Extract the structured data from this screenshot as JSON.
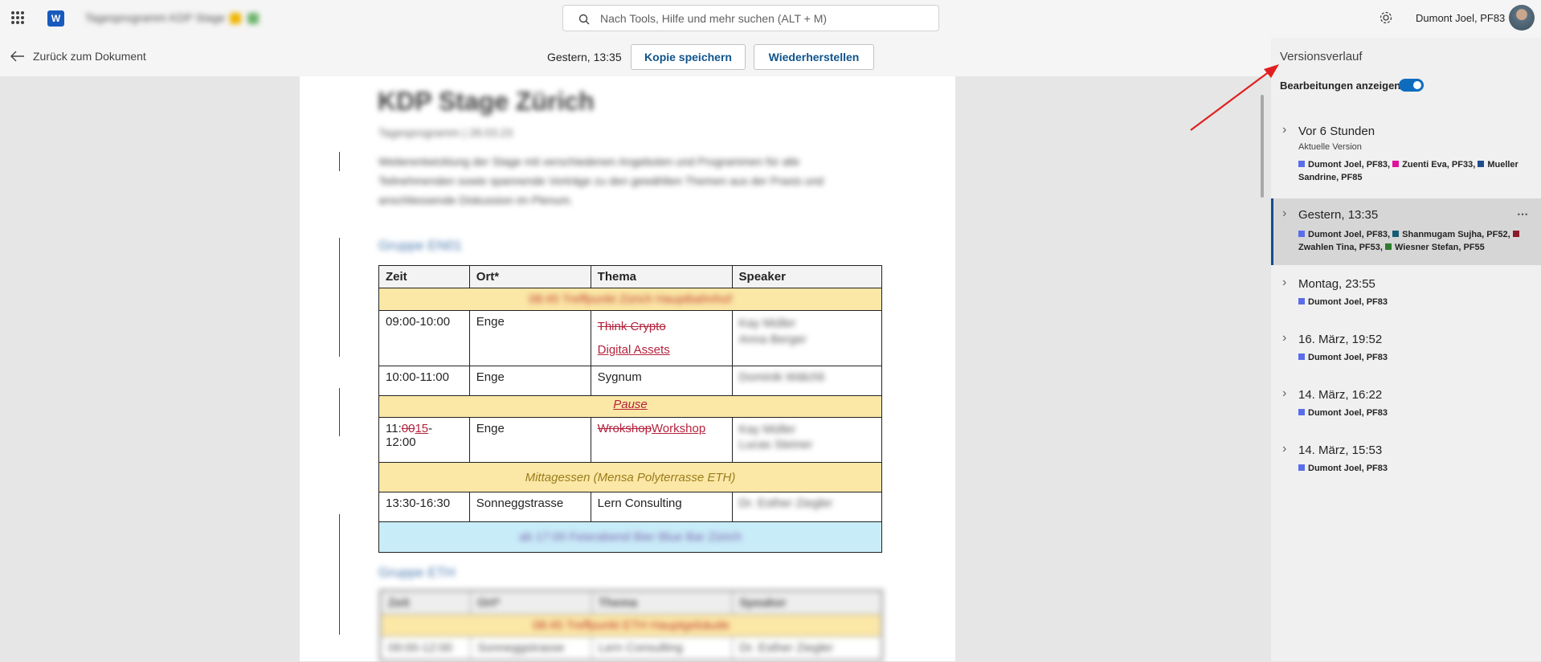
{
  "topbar": {
    "doc_title": "Tagesprogramm KDP Stage",
    "search_placeholder": "Nach Tools, Hilfe und mehr suchen (ALT + M)",
    "user_name": "Dumont Joel, PF83"
  },
  "commandbar": {
    "back_label": "Zurück zum Dokument",
    "version_time": "Gestern, 13:35",
    "copy_button": "Kopie speichern",
    "restore_button": "Wiederherstellen"
  },
  "document": {
    "title": "KDP Stage Zürich",
    "subtitle": "Tagesprogramm | 28.03.23",
    "paragraph": "Weiterentwicklung der Stage mit verschiedenen Angeboten und Programmen für alle Teilnehmenden sowie spannende Vorträge zu den gewählten Themen aus der Praxis und anschliessende Diskussion im Plenum.",
    "group1": "Gruppe EN01",
    "group2": "Gruppe ETH",
    "table1": {
      "headers": [
        "Zeit",
        "Ort*",
        "Thema",
        "Speaker"
      ],
      "row_banner": "08:45 Treffpunkt Zürich Hauptbahnhof",
      "rows": [
        {
          "zeit": "09:00-10:00",
          "ort": "Enge",
          "thema_del": "Think Crypto",
          "thema_ins": "Digital Assets",
          "speaker1": "Kay Müller",
          "speaker2": "Anna Berger"
        },
        {
          "zeit": "10:00-11:00",
          "ort": "Enge",
          "thema": "Sygnum",
          "speaker1": "Dominik Wälchli"
        },
        {
          "pause": "Pause"
        },
        {
          "zeit_a": "11:",
          "zeit_del": "00",
          "zeit_ins": "15",
          "zeit_b": "-",
          "zeit_c": "12:00",
          "ort": "Enge",
          "thema_del": "Wrokshop",
          "thema_ins": "Workshop",
          "speaker1": "Kay Müller",
          "speaker2": "Lucas Steiner"
        },
        {
          "lunch": "Mittagessen (Mensa Polyterrasse ETH)"
        },
        {
          "zeit": "13:30-16:30",
          "ort": "Sonneggstrasse",
          "thema": "Lern Consulting",
          "speaker1": "Dr. Esther Ziegler"
        },
        {
          "end": "ab 17:00 Feierabend Bier Blue Bar Zürich"
        }
      ]
    },
    "table2": {
      "headers": [
        "Zeit",
        "Ort*",
        "Thema",
        "Speaker"
      ],
      "row_banner": "08:45 Treffpunkt ETH Hauptgebäude",
      "row": [
        "09:00-12:00",
        "Sonneggstrasse",
        "Lern Consulting",
        "Dr. Esther Ziegler"
      ]
    }
  },
  "panel": {
    "title": "Versionsverlauf",
    "toggle_label": "Bearbeitungen anzeigen",
    "versions": [
      {
        "time": "Vor 6 Stunden",
        "current": "Aktuelle Version",
        "authors": [
          {
            "name": "Dumont Joel, PF83",
            "color": "#5b6ee8"
          },
          {
            "name": "Zuenti Eva, PF33",
            "color": "#e0119d"
          },
          {
            "name": "Mueller Sandrine, PF85",
            "color": "#1f4e8c"
          }
        ]
      },
      {
        "time": "Gestern, 13:35",
        "authors": [
          {
            "name": "Dumont Joel, PF83",
            "color": "#5b6ee8"
          },
          {
            "name": "Shanmugam Sujha, PF52",
            "color": "#155e75"
          },
          {
            "name": "Zwahlen Tina, PF53",
            "color": "#8b1a2b"
          },
          {
            "name": "Wiesner Stefan, PF55",
            "color": "#2d7d2d"
          }
        ]
      },
      {
        "time": "Montag, 23:55",
        "authors": [
          {
            "name": "Dumont Joel, PF83",
            "color": "#5b6ee8"
          }
        ]
      },
      {
        "time": "16. März, 19:52",
        "authors": [
          {
            "name": "Dumont Joel, PF83",
            "color": "#5b6ee8"
          }
        ]
      },
      {
        "time": "14. März, 16:22",
        "authors": [
          {
            "name": "Dumont Joel, PF83",
            "color": "#5b6ee8"
          }
        ]
      },
      {
        "time": "14. März, 15:53",
        "authors": [
          {
            "name": "Dumont Joel, PF83",
            "color": "#5b6ee8"
          }
        ]
      }
    ]
  }
}
